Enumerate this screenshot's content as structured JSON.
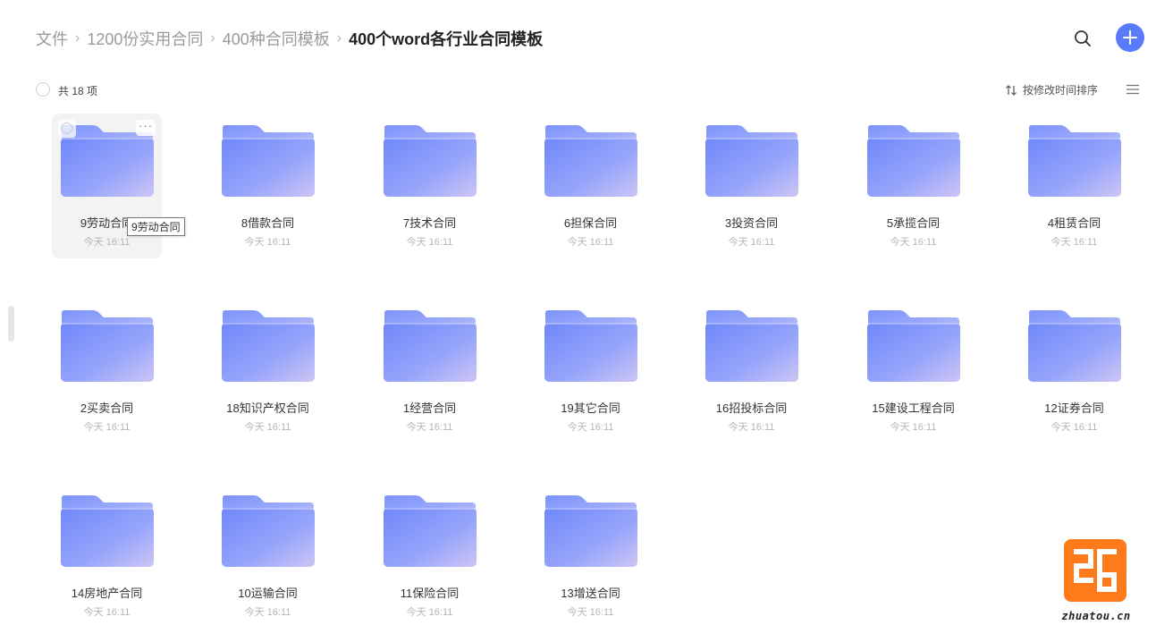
{
  "breadcrumb": [
    "文件",
    "1200份实用合同",
    "400种合同模板",
    "400个word各行业合同模板"
  ],
  "toolbar": {
    "search_icon": "search-icon",
    "add_icon": "plus-icon",
    "accent": "#5b7bff"
  },
  "subbar": {
    "count_label": "共 18 项",
    "sort_label": "按修改时间排序"
  },
  "tooltip": "9劳动合同",
  "files": [
    {
      "name": "9劳动合同",
      "date": "今天 16:11"
    },
    {
      "name": "8借款合同",
      "date": "今天 16:11"
    },
    {
      "name": "7技术合同",
      "date": "今天 16:11"
    },
    {
      "name": "6担保合同",
      "date": "今天 16:11"
    },
    {
      "name": "3投资合同",
      "date": "今天 16:11"
    },
    {
      "name": "5承揽合同",
      "date": "今天 16:11"
    },
    {
      "name": "4租赁合同",
      "date": "今天 16:11"
    },
    {
      "name": "2买卖合同",
      "date": "今天 16:11"
    },
    {
      "name": "18知识产权合同",
      "date": "今天 16:11"
    },
    {
      "name": "1经营合同",
      "date": "今天 16:11"
    },
    {
      "name": "19其它合同",
      "date": "今天 16:11"
    },
    {
      "name": "16招投标合同",
      "date": "今天 16:11"
    },
    {
      "name": "15建设工程合同",
      "date": "今天 16:11"
    },
    {
      "name": "12证券合同",
      "date": "今天 16:11"
    },
    {
      "name": "14房地产合同",
      "date": "今天 16:11"
    },
    {
      "name": "10运输合同",
      "date": "今天 16:11"
    },
    {
      "name": "11保险合同",
      "date": "今天 16:11"
    },
    {
      "name": "13增送合同",
      "date": "今天 16:11"
    }
  ],
  "watermark": {
    "text": "zhuatou.cn",
    "color": "#ff7a1a"
  }
}
